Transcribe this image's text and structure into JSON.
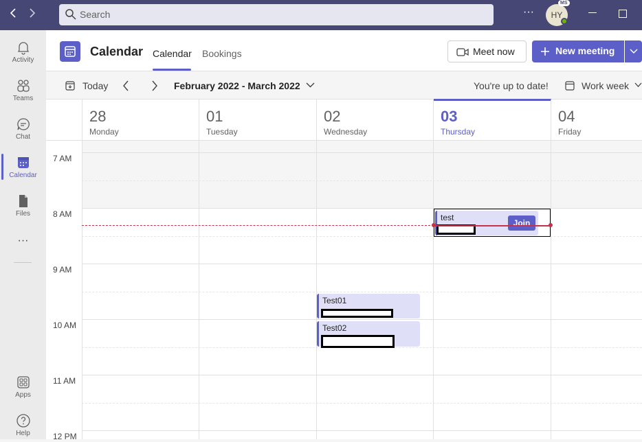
{
  "titlebar": {
    "search_placeholder": "Search",
    "avatar_initials": "HY",
    "avatar_badge": "MS",
    "more_glyph": "···"
  },
  "rail": {
    "items": [
      {
        "label": "Activity"
      },
      {
        "label": "Teams"
      },
      {
        "label": "Chat"
      },
      {
        "label": "Calendar"
      },
      {
        "label": "Files"
      },
      {
        "label": "Apps"
      },
      {
        "label": "Help"
      }
    ],
    "more_glyph": "···"
  },
  "header": {
    "title": "Calendar",
    "tabs": [
      {
        "label": "Calendar"
      },
      {
        "label": "Bookings"
      }
    ],
    "meet_now": "Meet now",
    "new_meeting": "New meeting"
  },
  "toolbar": {
    "today": "Today",
    "date_range": "February 2022 - March 2022",
    "status": "You're up to date!",
    "view": "Work week"
  },
  "days": [
    {
      "num": "28",
      "name": "Monday"
    },
    {
      "num": "01",
      "name": "Tuesday"
    },
    {
      "num": "02",
      "name": "Wednesday"
    },
    {
      "num": "03",
      "name": "Thursday"
    },
    {
      "num": "04",
      "name": "Friday"
    }
  ],
  "times": [
    "7 AM",
    "8 AM",
    "9 AM",
    "10 AM",
    "11 AM",
    "12 PM"
  ],
  "events": [
    {
      "title": "test",
      "day": "Thursday",
      "join": "Join"
    },
    {
      "title": "Test01",
      "day": "Wednesday"
    },
    {
      "title": "Test02",
      "day": "Wednesday"
    }
  ],
  "colors": {
    "accent": "#5b5fc7",
    "titlebar": "#464775",
    "now_line": "#c4314b"
  }
}
